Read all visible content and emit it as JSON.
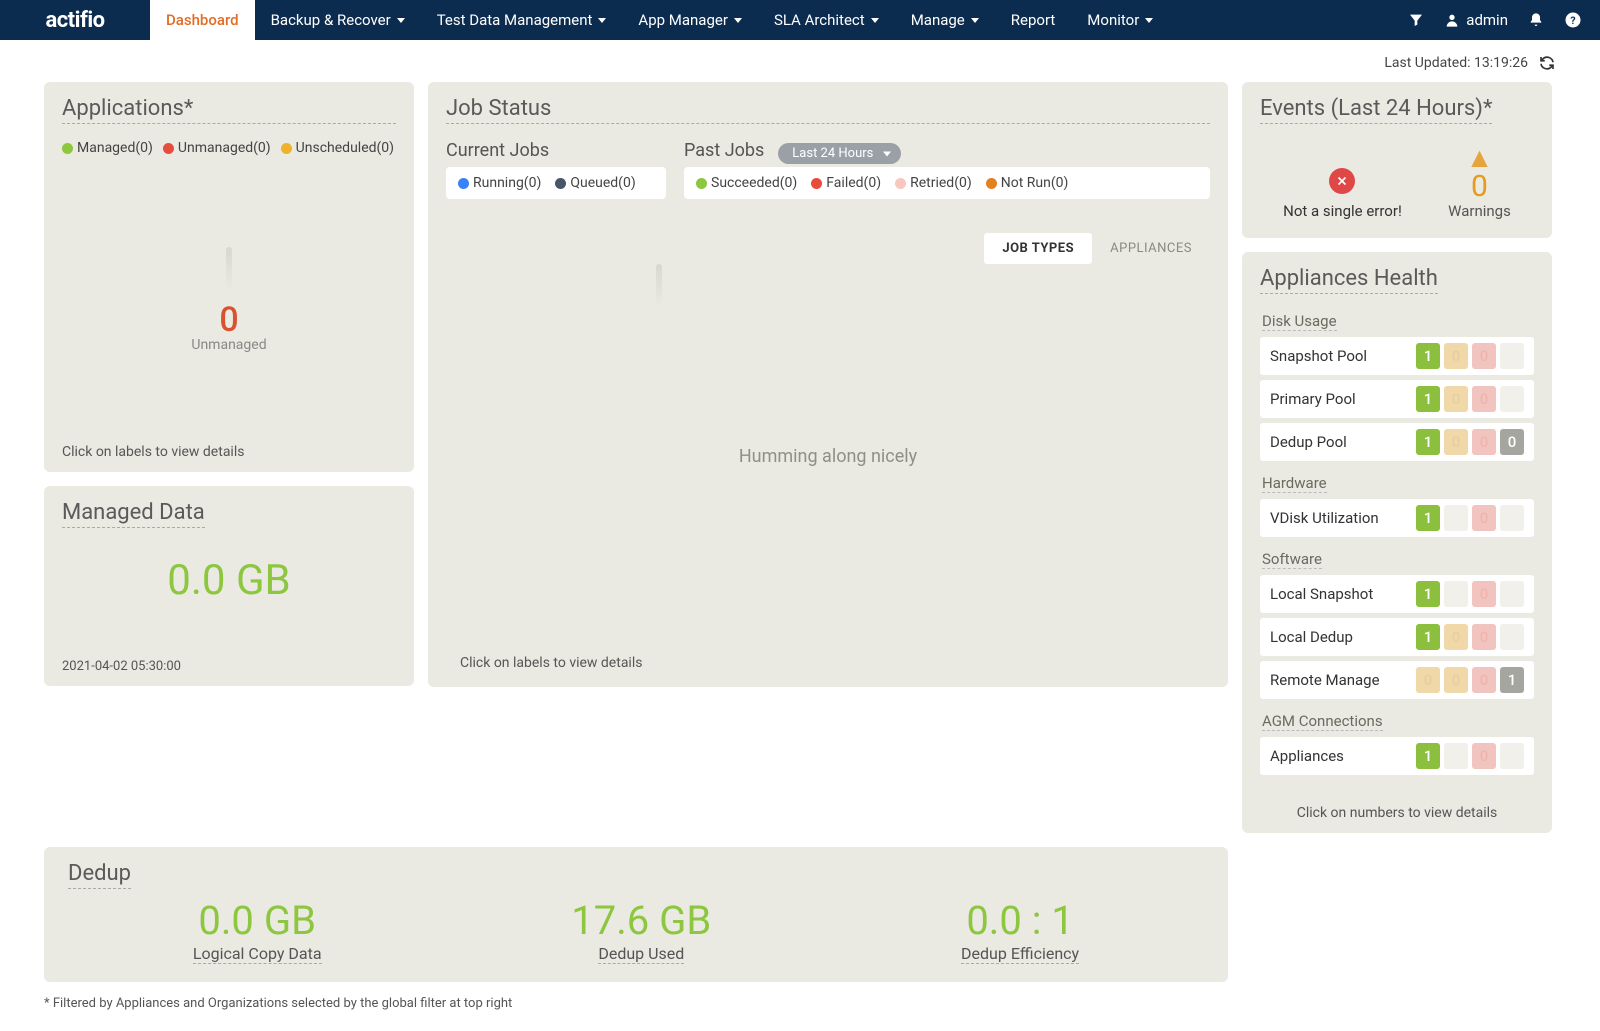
{
  "brand": "actifio",
  "nav": {
    "items": [
      {
        "label": "Dashboard",
        "dropdown": false,
        "active": true
      },
      {
        "label": "Backup & Recover",
        "dropdown": true,
        "active": false
      },
      {
        "label": "Test Data Management",
        "dropdown": true,
        "active": false
      },
      {
        "label": "App Manager",
        "dropdown": true,
        "active": false
      },
      {
        "label": "SLA Architect",
        "dropdown": true,
        "active": false
      },
      {
        "label": "Manage",
        "dropdown": true,
        "active": false
      },
      {
        "label": "Report",
        "dropdown": false,
        "active": false
      },
      {
        "label": "Monitor",
        "dropdown": true,
        "active": false
      }
    ],
    "user": "admin"
  },
  "updated": {
    "prefix": "Last Updated:",
    "time": "13:19:26"
  },
  "applications": {
    "title": "Applications*",
    "legend": [
      {
        "label": "Managed(0)",
        "color": "#8dc63f"
      },
      {
        "label": "Unmanaged(0)",
        "color": "#e74c3c"
      },
      {
        "label": "Unscheduled(0)",
        "color": "#eeb22b"
      }
    ],
    "big_value": "0",
    "big_label": "Unmanaged",
    "hint": "Click on labels to view details"
  },
  "managed_data": {
    "title": "Managed Data",
    "value": "0.0 GB",
    "timestamp": "2021-04-02 05:30:00"
  },
  "job_status": {
    "title": "Job Status",
    "current_title": "Current Jobs",
    "past_title": "Past Jobs",
    "range": "Last 24 Hours",
    "current_legend": [
      {
        "label": "Running(0)",
        "color": "#3b82f6"
      },
      {
        "label": "Queued(0)",
        "color": "#475569"
      }
    ],
    "past_legend": [
      {
        "label": "Succeeded(0)",
        "color": "#8dc63f"
      },
      {
        "label": "Failed(0)",
        "color": "#e74c3c"
      },
      {
        "label": "Retried(0)",
        "color": "#f8c7c0"
      },
      {
        "label": "Not Run(0)",
        "color": "#e67e22"
      }
    ],
    "tabs": {
      "job_types": "JOB TYPES",
      "appliances": "APPLIANCES"
    },
    "body_text": "Humming along nicely",
    "hint": "Click on labels to view details"
  },
  "events": {
    "title": "Events (Last 24 Hours)*",
    "no_error": "Not a single error!",
    "warn_count": "0",
    "warn_label": "Warnings"
  },
  "health": {
    "title": "Appliances Health",
    "sections": [
      {
        "name": "Disk Usage",
        "rows": [
          {
            "label": "Snapshot Pool",
            "p": [
              "1",
              "0",
              "0",
              ""
            ]
          },
          {
            "label": "Primary Pool",
            "p": [
              "1",
              "0",
              "0",
              ""
            ]
          },
          {
            "label": "Dedup Pool",
            "p": [
              "1",
              "0",
              "0",
              "0"
            ]
          }
        ]
      },
      {
        "name": "Hardware",
        "rows": [
          {
            "label": "VDisk Utilization",
            "p": [
              "1",
              "",
              "0",
              ""
            ]
          }
        ]
      },
      {
        "name": "Software",
        "rows": [
          {
            "label": "Local Snapshot",
            "p": [
              "1",
              "",
              "0",
              ""
            ]
          },
          {
            "label": "Local Dedup",
            "p": [
              "1",
              "0",
              "0",
              ""
            ]
          },
          {
            "label": "Remote Manage",
            "p": [
              "0",
              "0",
              "0",
              "1"
            ]
          }
        ]
      },
      {
        "name": "AGM Connections",
        "rows": [
          {
            "label": "Appliances",
            "p": [
              "1",
              "",
              "0",
              ""
            ]
          }
        ]
      }
    ],
    "hint": "Click on numbers to view details"
  },
  "dedup": {
    "title": "Dedup",
    "cols": [
      {
        "value": "0.0 GB",
        "label": "Logical Copy Data"
      },
      {
        "value": "17.6 GB",
        "label": "Dedup Used"
      },
      {
        "value": "0.0 : 1",
        "label": "Dedup Efficiency"
      }
    ]
  },
  "footnote": "* Filtered by Appliances and Organizations selected by the global filter at top right"
}
